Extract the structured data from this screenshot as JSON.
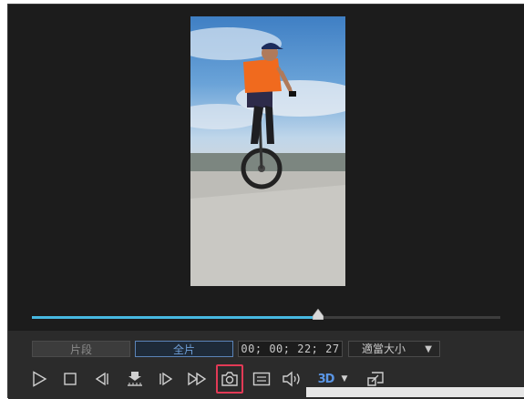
{
  "controls": {
    "mode_clip_label": "片段",
    "mode_full_label": "全片",
    "timecode": "00; 00; 22; 27",
    "zoom_label": "適當大小",
    "zoom_caret": "▼",
    "threed_label": "3D",
    "threed_caret": "▼"
  },
  "playback": {
    "position_fraction": 0.61
  },
  "icons": [
    "play-icon",
    "stop-icon",
    "previous-frame-icon",
    "fast-forward-extract-icon",
    "next-frame-icon",
    "fast-forward-icon",
    "camera-snapshot-icon",
    "subtitle-icon",
    "volume-icon",
    "3d-icon",
    "external-display-icon"
  ],
  "colors": {
    "accent": "#47b8e0",
    "highlight": "#e23a56",
    "threed": "#5a96e6"
  }
}
